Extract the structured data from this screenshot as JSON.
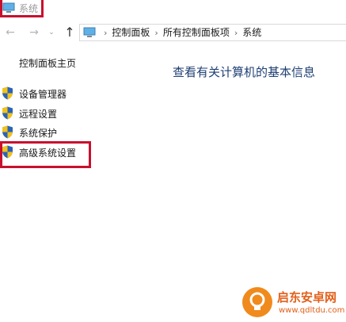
{
  "window": {
    "title": "系统"
  },
  "nav": {
    "back_glyph": "←",
    "forward_glyph": "→",
    "dropdown_glyph": "⌄",
    "up_glyph": "↑"
  },
  "breadcrumb": {
    "items": [
      "控制面板",
      "所有控制面板项",
      "系统"
    ],
    "separator": "›"
  },
  "sidebar": {
    "home_label": "控制面板主页",
    "items": [
      {
        "label": "设备管理器",
        "icon": "shield-icon"
      },
      {
        "label": "远程设置",
        "icon": "shield-icon"
      },
      {
        "label": "系统保护",
        "icon": "shield-icon"
      },
      {
        "label": "高级系统设置",
        "icon": "shield-icon"
      }
    ]
  },
  "main": {
    "heading": "查看有关计算机的基本信息"
  },
  "watermark": {
    "name": "启东安卓网",
    "url": "www.qdltdu.com"
  },
  "colors": {
    "highlight": "#c8102e",
    "heading": "#1e3f73",
    "watermark": "#e2601a"
  }
}
